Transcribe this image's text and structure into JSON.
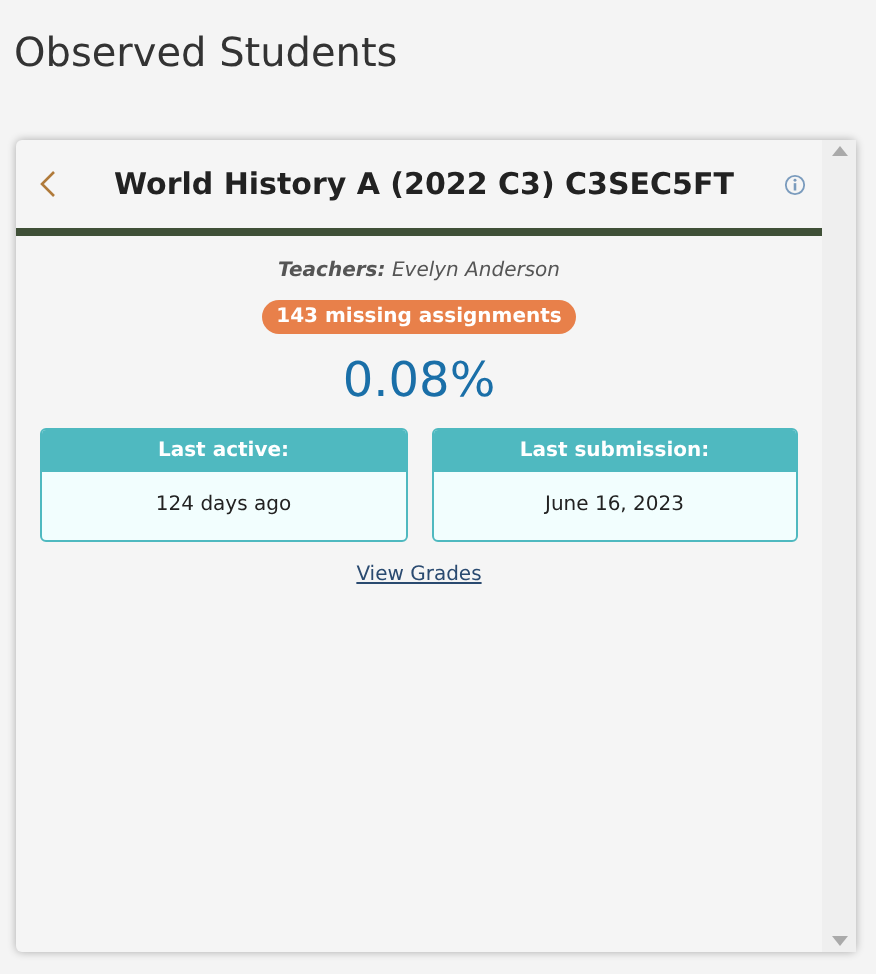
{
  "page_title": "Observed Students",
  "card": {
    "title": "World History A (2022 C3) C3SEC5FT",
    "teachers_label": "Teachers:",
    "teachers": "Evelyn Anderson",
    "missing_badge": "143 missing assignments",
    "grade": "0.08%",
    "stats": [
      {
        "label": "Last active:",
        "value": "124 days ago"
      },
      {
        "label": "Last submission:",
        "value": "June 16, 2023"
      }
    ],
    "link": "View Grades"
  }
}
